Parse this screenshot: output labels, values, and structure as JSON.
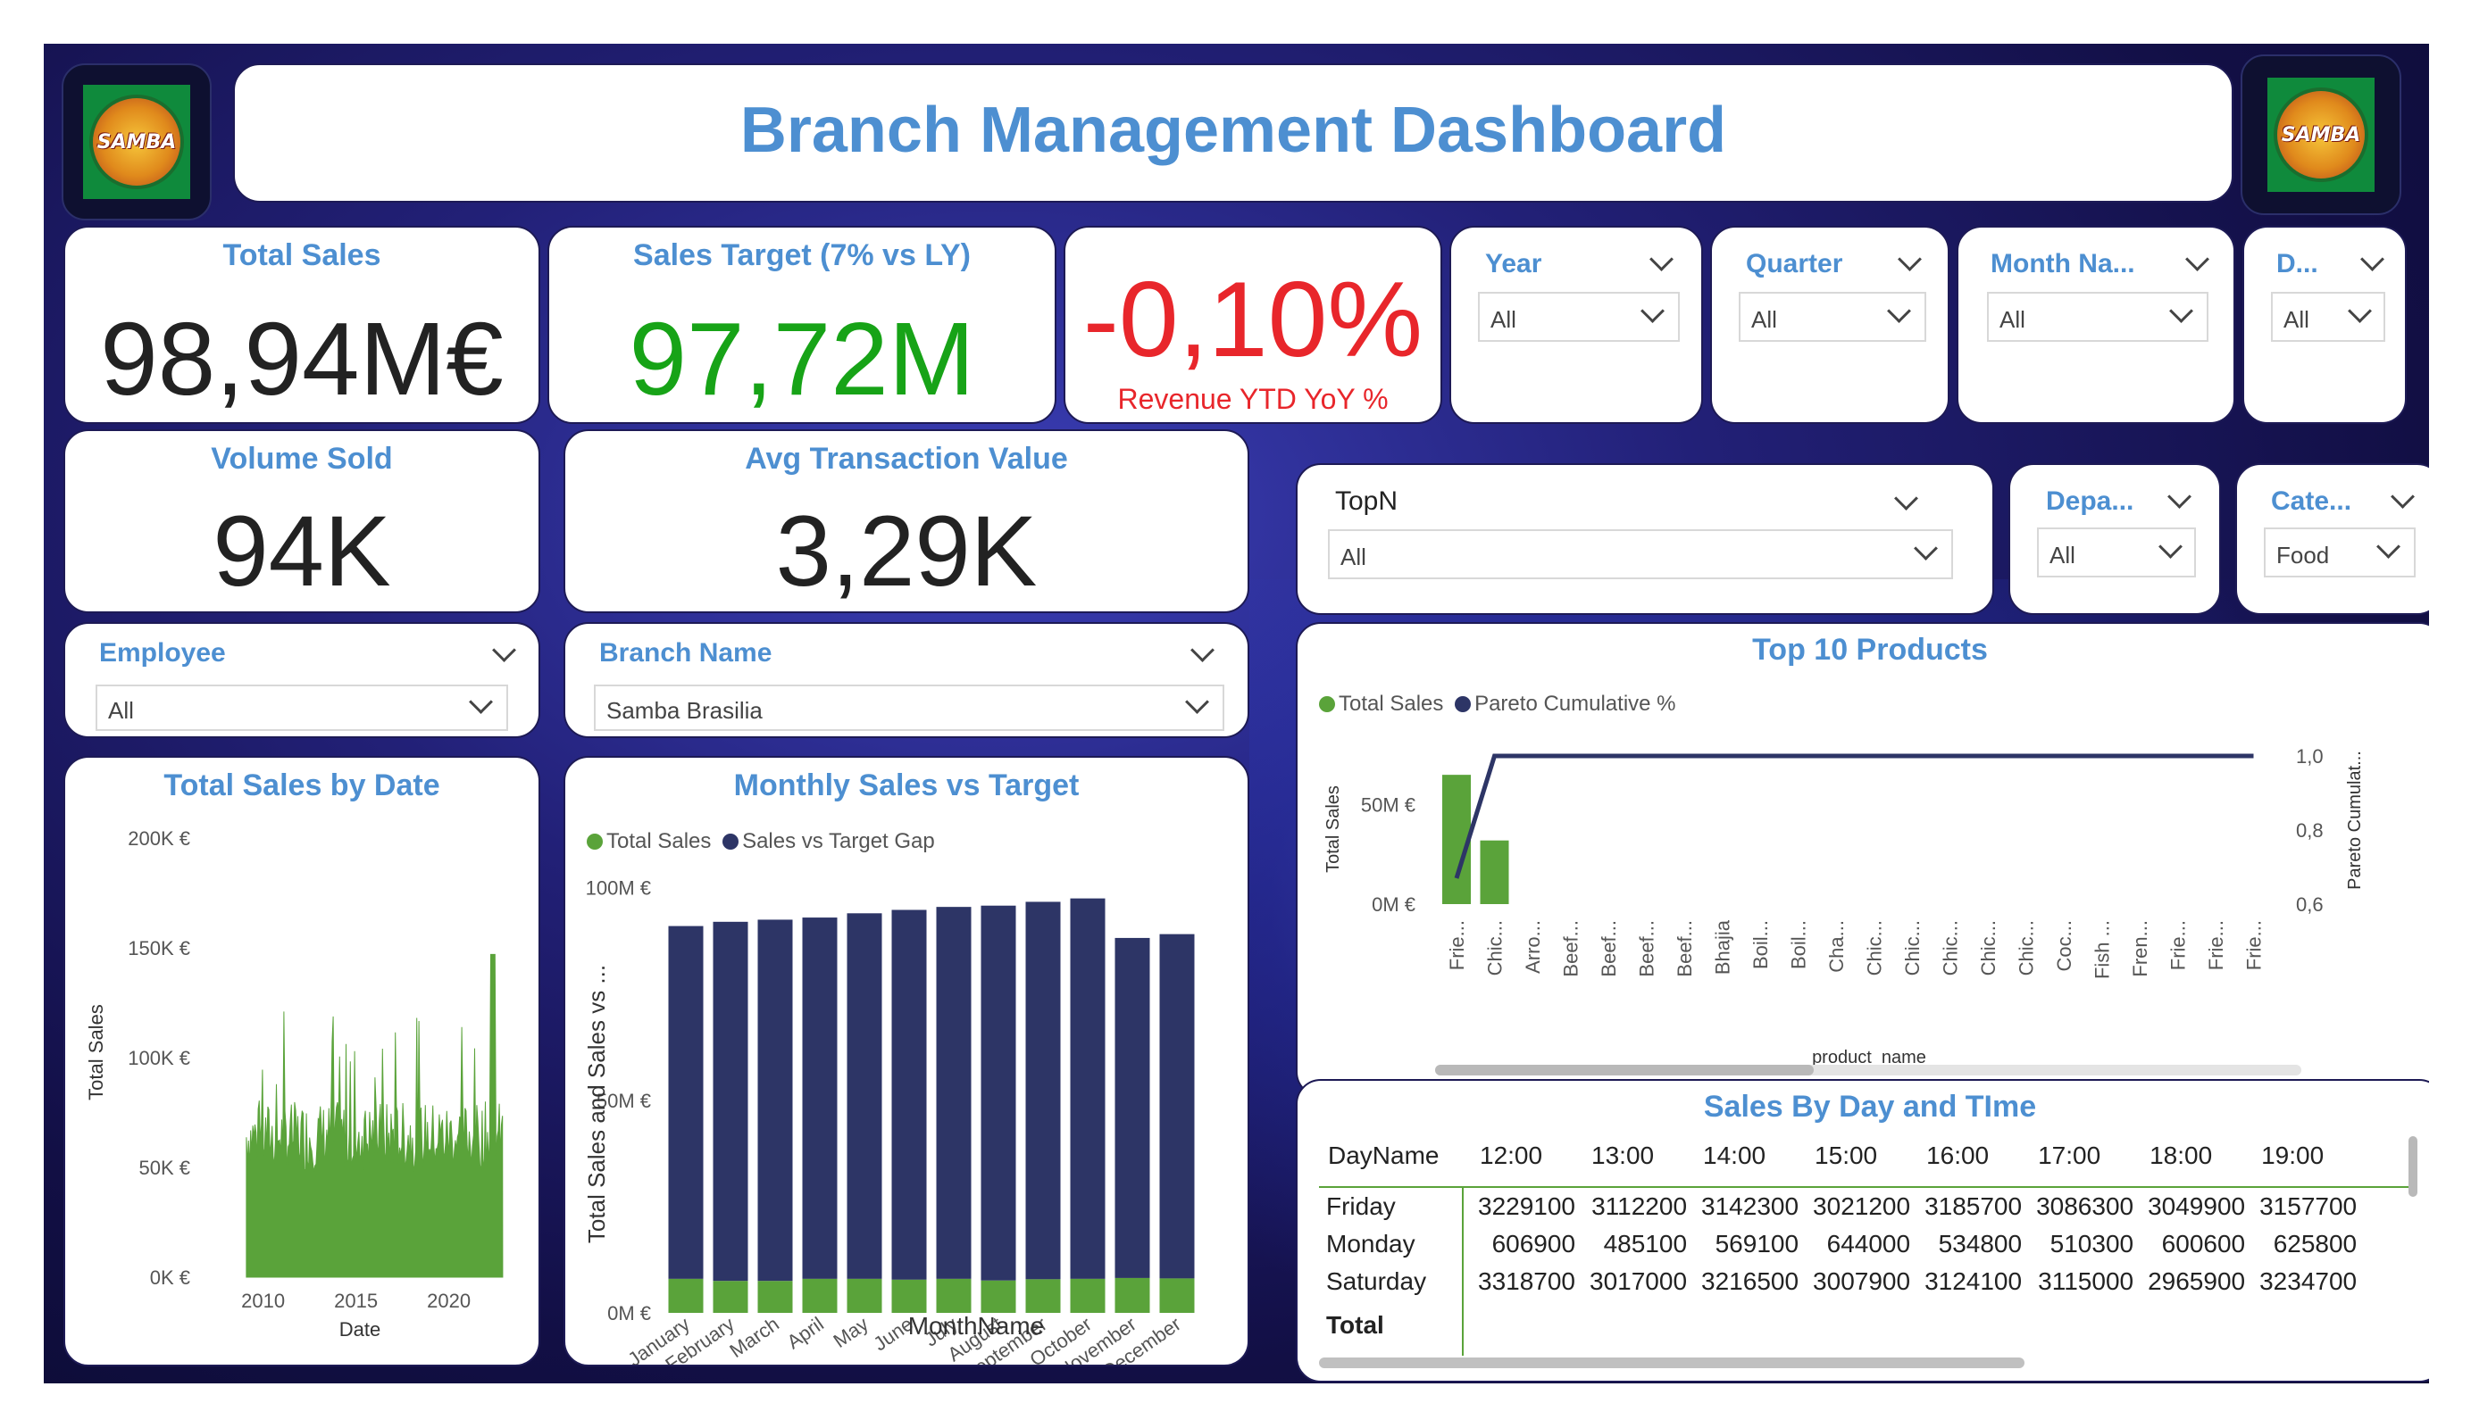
{
  "header": {
    "title": "Branch Management Dashboard",
    "logo_text": "SAMBA"
  },
  "kpis": {
    "total_sales": {
      "label": "Total Sales",
      "value": "98,94M€"
    },
    "sales_target": {
      "label": "Sales Target (7% vs LY)",
      "value": "97,72M"
    },
    "revenue_yoy": {
      "label": "Revenue YTD YoY %",
      "value": "-0,10%"
    },
    "volume_sold": {
      "label": "Volume Sold",
      "value": "94K"
    },
    "avg_transaction": {
      "label": "Avg Transaction Value",
      "value": "3,29K"
    }
  },
  "slicers": {
    "year": {
      "label": "Year",
      "value": "All"
    },
    "quarter": {
      "label": "Quarter",
      "value": "All"
    },
    "month_name": {
      "label": "Month Na...",
      "value": "All"
    },
    "day": {
      "label": "D...",
      "value": "All"
    },
    "topn": {
      "label": "TopN",
      "value": "All"
    },
    "department": {
      "label": "Depa...",
      "value": "All"
    },
    "category": {
      "label": "Cate...",
      "value": "Food"
    },
    "employee": {
      "label": "Employee",
      "value": "All"
    },
    "branch_name": {
      "label": "Branch Name",
      "value": "Samba Brasilia"
    }
  },
  "colors": {
    "green": "#5aa33a",
    "navy": "#2d3566",
    "title_blue": "#4d8fd1",
    "red": "#e8262b",
    "target_green": "#17a317"
  },
  "chart_data": [
    {
      "id": "total_sales_by_date",
      "type": "area",
      "title": "Total Sales by Date",
      "xlabel": "Date",
      "ylabel": "Total Sales",
      "x_ticks": [
        "2010",
        "2015",
        "2020"
      ],
      "y_ticks": [
        "0K €",
        "50K €",
        "100K €",
        "150K €",
        "200K €"
      ],
      "ylim": [
        0,
        200000
      ],
      "xlim": [
        2008,
        2023
      ],
      "series": [
        {
          "color": "#5aa33a"
        }
      ]
    },
    {
      "id": "monthly_sales_vs_target",
      "type": "bar",
      "title": "Monthly Sales vs Target",
      "xlabel": "MonthName",
      "ylabel": "Total Sales and Sales vs ...",
      "legend": [
        "Total Sales",
        "Sales vs Target Gap"
      ],
      "categories": [
        "January",
        "February",
        "March",
        "April",
        "May",
        "June",
        "July",
        "August",
        "September",
        "October",
        "November",
        "December"
      ],
      "y_ticks": [
        "0M €",
        "50M €",
        "100M €"
      ],
      "ylim": [
        0,
        100000000
      ],
      "series": [
        {
          "name": "Total Sales",
          "values": [
            8000000,
            7500000,
            7500000,
            8000000,
            8000000,
            7800000,
            8000000,
            7600000,
            7900000,
            8000000,
            8200000,
            8100000
          ]
        },
        {
          "name": "Sales vs Target Gap",
          "values": [
            83000000,
            84500000,
            85000000,
            85000000,
            86000000,
            87000000,
            87500000,
            88200000,
            88800000,
            89500000,
            80000000,
            81000000
          ]
        }
      ]
    },
    {
      "id": "top_10_products",
      "type": "bar",
      "title": "Top 10 Products",
      "xlabel": "product_name",
      "ylabel": "Total Sales",
      "y2label": "Pareto Cumulat...",
      "legend": [
        "Total Sales",
        "Pareto Cumulative %"
      ],
      "categories": [
        "Frie...",
        "Chic...",
        "Arro...",
        "Beef...",
        "Beef...",
        "Beef...",
        "Beef...",
        "Bhajia",
        "Boil...",
        "Boil...",
        "Cha...",
        "Chic...",
        "Chic...",
        "Chic...",
        "Chic...",
        "Chic...",
        "Coc...",
        "Fish ...",
        "Fren...",
        "Frie...",
        "Frie...",
        "Frie..."
      ],
      "y_ticks": [
        "0M €",
        "50M €"
      ],
      "y2_ticks": [
        "0,6",
        "0,8",
        "1,0"
      ],
      "series": [
        {
          "name": "Total Sales",
          "values": [
            65000000,
            32000000,
            0,
            0,
            0,
            0,
            0,
            0,
            0,
            0,
            0,
            0,
            0,
            0,
            0,
            0,
            0,
            0,
            0,
            0,
            0,
            0
          ]
        },
        {
          "name": "Pareto Cumulative %",
          "values": [
            0.67,
            1.0,
            1.0,
            1.0,
            1.0,
            1.0,
            1.0,
            1.0,
            1.0,
            1.0,
            1.0,
            1.0,
            1.0,
            1.0,
            1.0,
            1.0,
            1.0,
            1.0,
            1.0,
            1.0,
            1.0,
            1.0
          ]
        }
      ]
    },
    {
      "id": "sales_by_day_and_time",
      "type": "table",
      "title": "Sales By Day and TIme",
      "columns": [
        "DayName",
        "12:00",
        "13:00",
        "14:00",
        "15:00",
        "16:00",
        "17:00",
        "18:00",
        "19:00"
      ],
      "rows": [
        {
          "day": "Friday",
          "values": [
            "3229100",
            "3112200",
            "3142300",
            "3021200",
            "3185700",
            "3086300",
            "3049900",
            "3157700"
          ]
        },
        {
          "day": "Monday",
          "values": [
            "606900",
            "485100",
            "569100",
            "644000",
            "534800",
            "510300",
            "600600",
            "625800"
          ]
        },
        {
          "day": "Saturday",
          "values": [
            "3318700",
            "3017000",
            "3216500",
            "3007900",
            "3124100",
            "3115000",
            "2965900",
            "3234700"
          ]
        }
      ],
      "total_label": "Total"
    }
  ]
}
